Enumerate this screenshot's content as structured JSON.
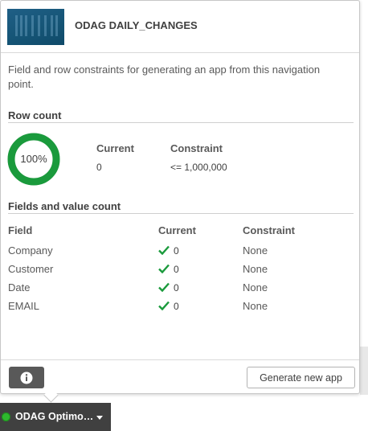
{
  "header": {
    "title": "ODAG DAILY_CHANGES"
  },
  "description": "Field and row constraints for generating an app from this navigation point.",
  "row_count": {
    "section_title": "Row count",
    "percent_label": "100%",
    "percent_value": 1.0,
    "current_header": "Current",
    "constraint_header": "Constraint",
    "current_value": "0",
    "constraint_value": "<= 1,000,000",
    "ring_color": "#1a9a3c"
  },
  "fields": {
    "section_title": "Fields and value count",
    "headers": {
      "field": "Field",
      "current": "Current",
      "constraint": "Constraint"
    },
    "rows": [
      {
        "field": "Company",
        "current": "0",
        "constraint": "None"
      },
      {
        "field": "Customer",
        "current": "0",
        "constraint": "None"
      },
      {
        "field": "Date",
        "current": "0",
        "constraint": "None"
      },
      {
        "field": "EMAIL",
        "current": "0",
        "constraint": "None"
      }
    ]
  },
  "footer": {
    "info_icon": "info-icon",
    "generate_label": "Generate new app"
  },
  "tab": {
    "label": "ODAG Optimo…",
    "status_color": "#2eb82e"
  }
}
